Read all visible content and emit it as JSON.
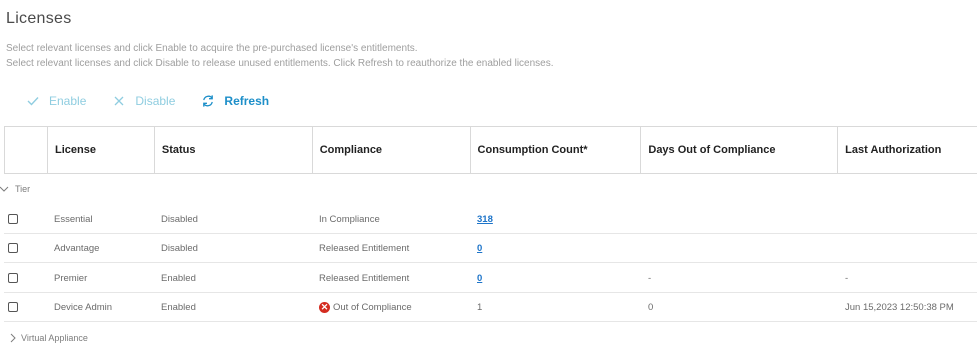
{
  "page": {
    "title": "Licenses",
    "description_line1": "Select relevant licenses and click Enable to acquire the pre-purchased license's entitlements.",
    "description_line2": "Select relevant licenses and click Disable to release unused entitlements. Click Refresh to reauthorize the enabled licenses."
  },
  "toolbar": {
    "enable_label": "Enable",
    "disable_label": "Disable",
    "refresh_label": "Refresh"
  },
  "table": {
    "columns": [
      "License",
      "Status",
      "Compliance",
      "Consumption Count*",
      "Days Out of Compliance",
      "Last Authorization"
    ],
    "groups": {
      "tier": "Tier",
      "virtual_appliance": "Virtual Appliance"
    },
    "rows": [
      {
        "license": "Essential",
        "status": "Disabled",
        "compliance": "In Compliance",
        "consumption": "318",
        "days_out": "",
        "last_auth": ""
      },
      {
        "license": "Advantage",
        "status": "Disabled",
        "compliance": "Released Entitlement",
        "consumption": "0",
        "days_out": "",
        "last_auth": ""
      },
      {
        "license": "Premier",
        "status": "Enabled",
        "compliance": "Released Entitlement",
        "consumption": "0",
        "days_out": "-",
        "last_auth": "-"
      },
      {
        "license": "Device Admin",
        "status": "Enabled",
        "compliance": "Out of Compliance",
        "consumption": "1",
        "days_out": "0",
        "last_auth": "Jun 15,2023 12:50:38 PM"
      }
    ]
  },
  "colors": {
    "accent": "#1d8fc9",
    "accent_disabled": "#8fcde0",
    "link": "#1d74c9",
    "error": "#d42c20"
  }
}
